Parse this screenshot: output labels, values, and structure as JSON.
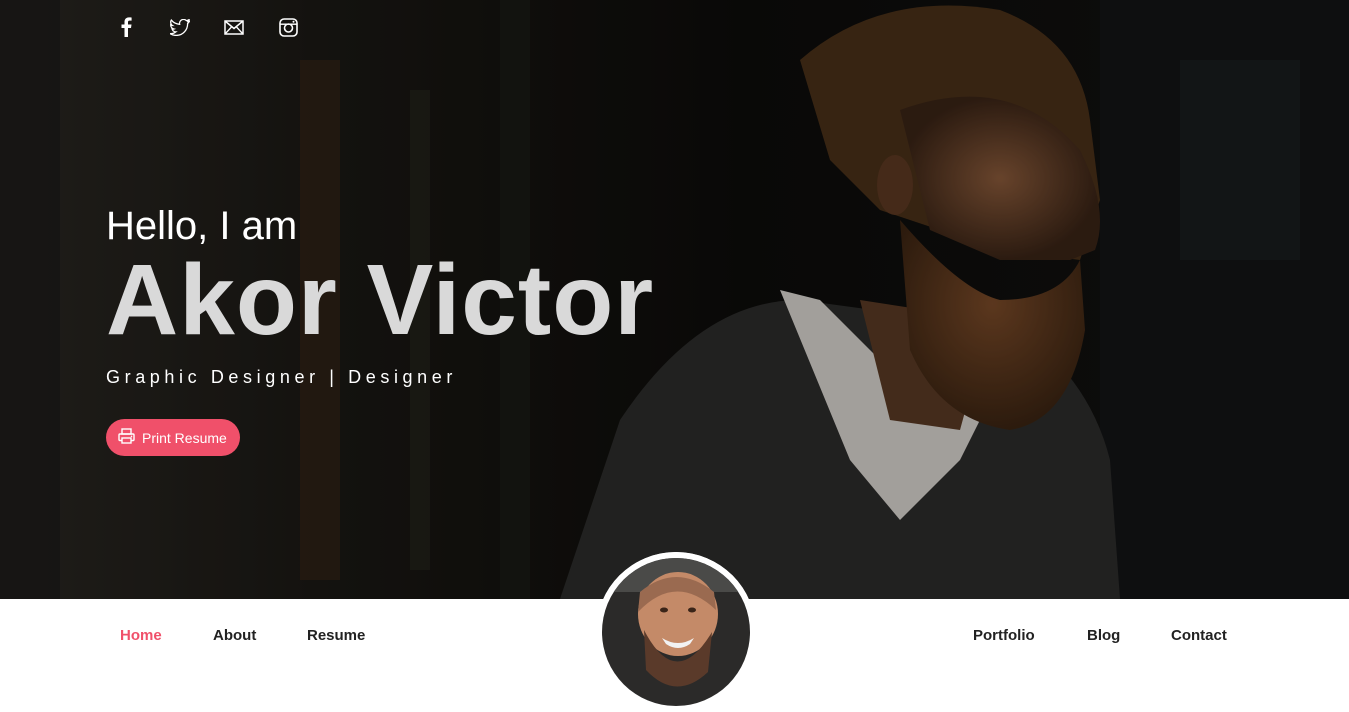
{
  "social": {
    "icons": [
      "facebook-icon",
      "twitter-icon",
      "mail-icon",
      "instagram-icon"
    ]
  },
  "hero": {
    "greeting": "Hello, I am",
    "name": "Akor Victor",
    "role": "Graphic Designer | Designer",
    "print_button_label": "Print Resume",
    "print_button_icon": "printer-icon"
  },
  "nav": {
    "items": [
      {
        "label": "Home",
        "active": true
      },
      {
        "label": "About",
        "active": false
      },
      {
        "label": "Resume",
        "active": false
      },
      {
        "label": "Portfolio",
        "active": false
      },
      {
        "label": "Blog",
        "active": false
      },
      {
        "label": "Contact",
        "active": false
      }
    ]
  },
  "colors": {
    "accent": "#f0506a",
    "hero_overlay": "#0b0b0a",
    "name_text": "#d9d9d9"
  }
}
